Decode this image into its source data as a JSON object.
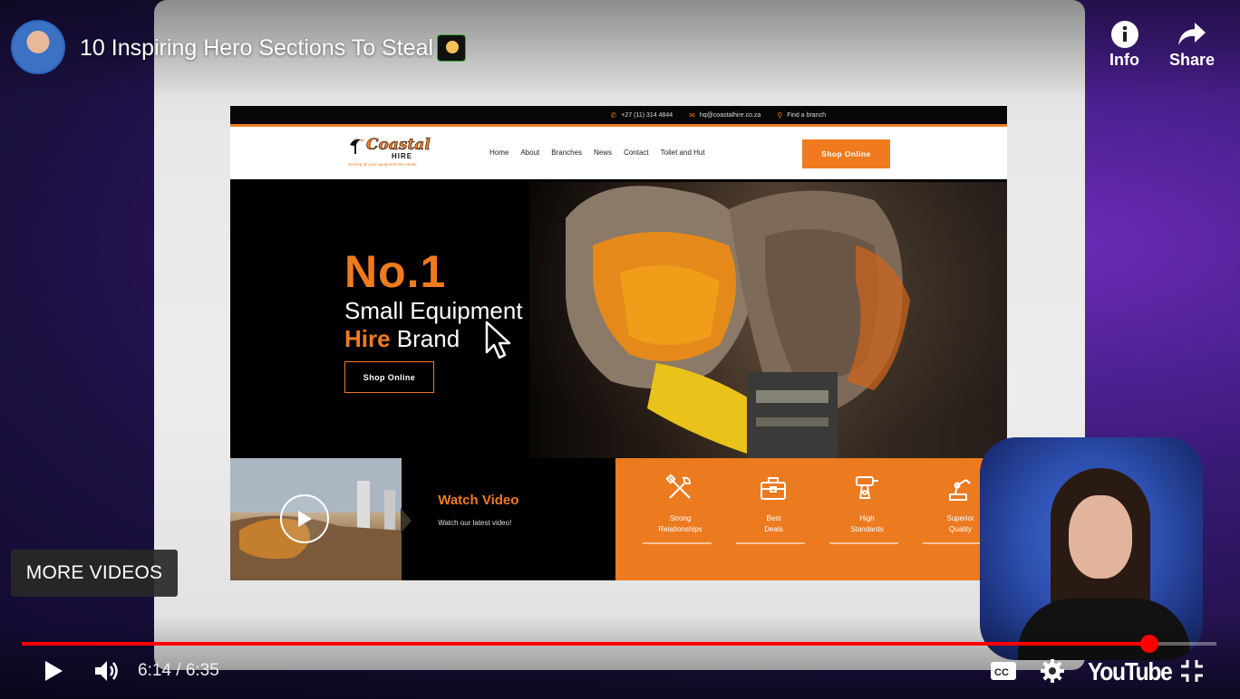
{
  "player": {
    "video_title": "10 Inspiring Hero Sections To Steal",
    "info_label": "Info",
    "share_label": "Share",
    "more_videos_label": "MORE VIDEOS",
    "time_current": "6:14",
    "time_separator": "/",
    "time_total": "6:35",
    "progress_fraction": 0.9435,
    "brand_label": "YouTube",
    "accent_color": "#ff0000"
  },
  "site": {
    "topbar": {
      "phone": "+27 (11) 314 4844",
      "email": "hq@coastalhire.co.za",
      "branch": "Find a branch"
    },
    "logo": {
      "name": "Coastal",
      "sub": "HIRE",
      "tagline": "Serving all your equipment hire needs"
    },
    "nav": [
      "Home",
      "About",
      "Branches",
      "News",
      "Contact",
      "Toilet and Hut"
    ],
    "nav_cta": "Shop Online",
    "hero": {
      "headline": "No.1",
      "line1": "Small Equipment",
      "line2_accent": "Hire",
      "line2_rest": " Brand",
      "cta": "Shop Online"
    },
    "watch_video": {
      "title": "Watch Video",
      "subtitle": "Watch our latest video!"
    },
    "features": [
      {
        "label_1": "Strong",
        "label_2": "Relationships",
        "icon": "tools-icon"
      },
      {
        "label_1": "Best",
        "label_2": "Deals",
        "icon": "toolbox-icon"
      },
      {
        "label_1": "High",
        "label_2": "Standards",
        "icon": "drill-icon"
      },
      {
        "label_1": "Superior",
        "label_2": "Quality",
        "icon": "robot-arm-icon"
      }
    ],
    "accent_color": "#f07b1f"
  }
}
